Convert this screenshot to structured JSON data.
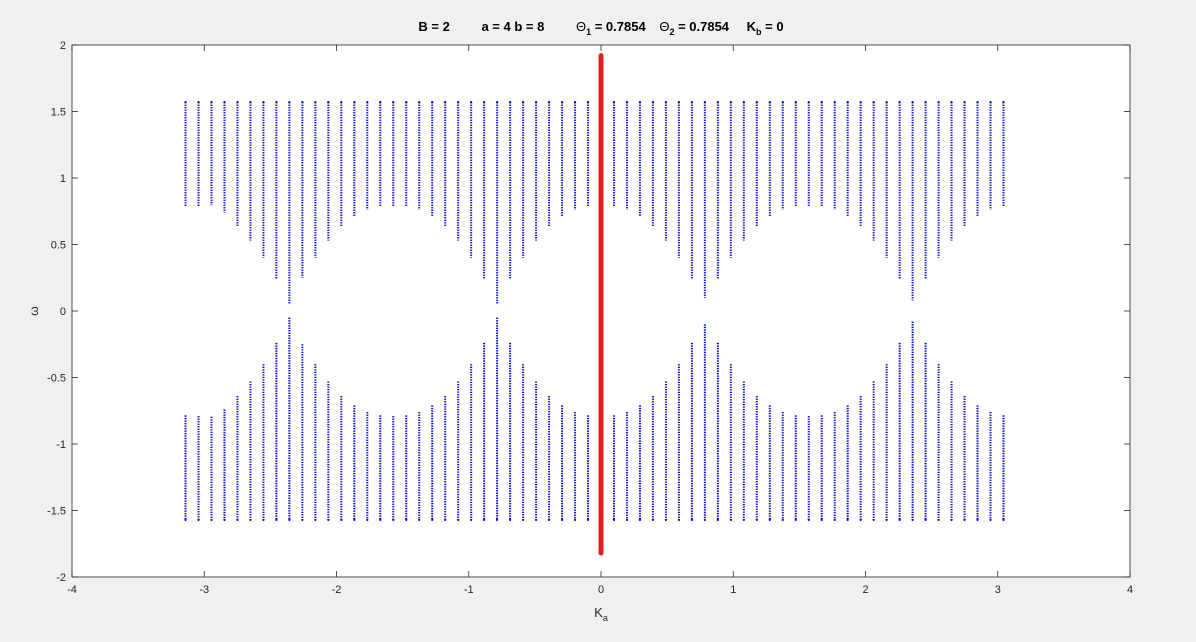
{
  "title": {
    "B": "B = 2",
    "ab": "a = 4   b = 8",
    "theta1_sym": "Θ",
    "theta1_sub": "1",
    "theta1_val": " = 0.7854",
    "theta2_sym": "Θ",
    "theta2_sub": "2",
    "theta2_val": " = 0.7854",
    "kb_sym": "K",
    "kb_sub": "b",
    "kb_val": " = 0"
  },
  "xlabel": {
    "main": "K",
    "sub": "a"
  },
  "ylabel": "ω",
  "chart_data": {
    "type": "scatter",
    "xlim": [
      -4,
      4
    ],
    "ylim": [
      -2,
      2
    ],
    "x_ticks": [
      -4,
      -3,
      -2,
      -1,
      0,
      1,
      2,
      3,
      4
    ],
    "y_ticks": [
      -2,
      -1.5,
      -1,
      -0.5,
      0,
      0.5,
      1,
      1.5,
      2
    ],
    "x_tick_labels": [
      "-4",
      "-3",
      "-2",
      "-1",
      "0",
      "1",
      "2",
      "3",
      "4"
    ],
    "y_tick_labels": [
      "-2",
      "-1.5",
      "-1",
      "-0.5",
      "0",
      "0.5",
      "1",
      "1.5",
      "2"
    ],
    "grid": false,
    "series": [
      {
        "color": "#0000cc",
        "marker": "dot",
        "x": [
          -3.1416,
          -3.0434,
          -2.9452,
          -2.8471,
          -2.7489,
          -2.6507,
          -2.5525,
          -2.4544,
          -2.3562,
          -2.258,
          -2.1598,
          -2.0617,
          -1.9635,
          -1.8653,
          -1.7671,
          -1.669,
          -1.5708,
          -1.4726,
          -1.3744,
          -1.2763,
          -1.1781,
          -1.0799,
          -0.9817,
          -0.8836,
          -0.7854,
          -0.6872,
          -0.589,
          -0.4909,
          -0.3927,
          -0.2945,
          -0.1963,
          -0.0982,
          0.0,
          0.0982,
          0.1963,
          0.2945,
          0.3927,
          0.4909,
          0.589,
          0.6872,
          0.7854,
          0.8836,
          0.9817,
          1.0799,
          1.1781,
          1.2763,
          1.3744,
          1.4726,
          1.5708,
          1.669,
          1.7671,
          1.8653,
          1.9635,
          2.0617,
          2.1598,
          2.258,
          2.3562,
          2.4544,
          2.5525,
          2.6507,
          2.7489,
          2.8471,
          2.9452,
          3.0434
        ],
        "band_min": [
          0.785,
          0.79,
          0.795,
          0.74,
          0.64,
          0.53,
          0.4,
          0.24,
          0.05,
          0.25,
          0.4,
          0.53,
          0.64,
          0.71,
          0.76,
          0.785,
          0.79,
          0.785,
          0.76,
          0.71,
          0.64,
          0.53,
          0.4,
          0.24,
          0.05,
          0.24,
          0.4,
          0.53,
          0.64,
          0.71,
          0.76,
          0.785,
          0.79,
          0.785,
          0.76,
          0.71,
          0.64,
          0.53,
          0.4,
          0.24,
          0.1,
          0.24,
          0.4,
          0.53,
          0.64,
          0.71,
          0.76,
          0.785,
          0.79,
          0.785,
          0.76,
          0.71,
          0.64,
          0.53,
          0.4,
          0.24,
          0.08,
          0.24,
          0.4,
          0.53,
          0.64,
          0.71,
          0.76,
          0.785
        ],
        "band_max": 1.5708,
        "symmetric": true
      },
      {
        "color": "#e02020",
        "marker": "line",
        "x": [
          0,
          0
        ],
        "y": [
          -1.82,
          1.92
        ]
      }
    ]
  }
}
